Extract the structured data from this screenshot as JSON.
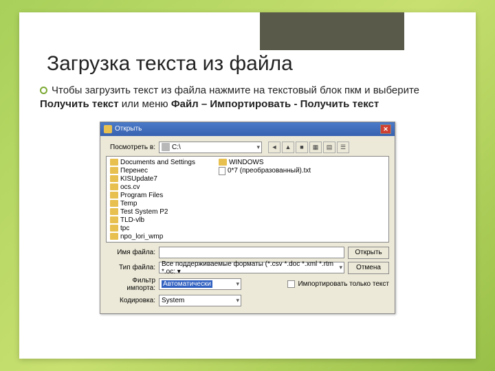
{
  "slide": {
    "title": "Загрузка текста из файла",
    "body_p1": "Чтобы загрузить текст из файла нажмите на текстовый блок пкм и выберите ",
    "body_b1": "Получить текст",
    "body_p2": " или меню ",
    "body_b2": "Файл – Импортировать - Получить текст"
  },
  "dialog": {
    "title": "Открыть",
    "look_label": "Посмотреть в:",
    "look_value": "C:\\",
    "nav": [
      "◄",
      "▲",
      "■",
      "▦",
      "▤",
      "☰"
    ],
    "files_col1": [
      "Documents and Settings",
      "Перенес",
      "KISUpdate7",
      "ocs.cv",
      "Program Files",
      "Temp",
      "Test System P2",
      "TLD-vlb",
      "tpc",
      "npo_lori_wmp"
    ],
    "files_col2_folder": "WINDOWS",
    "files_col2_file": "0*7 (преобразованный).txt",
    "filename_label": "Имя файла:",
    "filename_value": "",
    "filetype_label": "Тип файла:",
    "filetype_value": "Все поддерживаемые форматы (*.csv *.doc *.xml *.rtm *.oc: ▾",
    "filter_label": "Фильтр импорта:",
    "filter_value": "Автоматически",
    "checkbox_label": "Импортировать только текст",
    "encoding_label": "Кодировка:",
    "encoding_value": "System",
    "open_btn": "Открыть",
    "cancel_btn": "Отмена"
  }
}
